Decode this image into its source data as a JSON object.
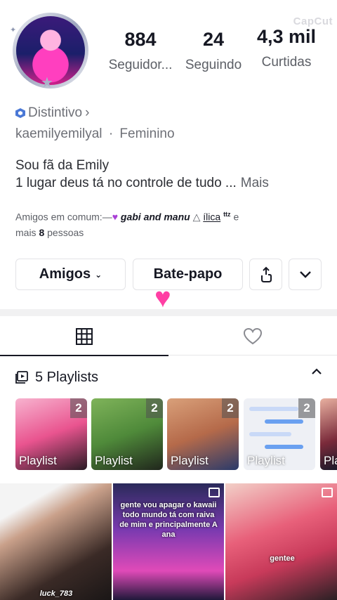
{
  "watermark": "CapCut",
  "stats": [
    {
      "value": "884",
      "label": "Seguidor..."
    },
    {
      "value": "24",
      "label": "Seguindo"
    },
    {
      "value": "4,3 mil",
      "label": "Curtidas"
    }
  ],
  "badge": {
    "label": "Distintivo",
    "arrow": "›"
  },
  "user": {
    "handle": "kaemilyemilyal",
    "separator": "·",
    "gender": "Feminino"
  },
  "bio": {
    "line1": "Sou fã da Emily",
    "line2": "1 lugar deus tá no controle de tudo ...",
    "more": "Mais"
  },
  "friends": {
    "prefix": "Amigos em comum:",
    "name1": "gabi and manu",
    "name2": "ílica",
    "suffix_e": "e",
    "mais": "mais",
    "count": "8",
    "pessoas": "pessoas"
  },
  "buttons": {
    "friends": "Amigos",
    "chat": "Bate-papo"
  },
  "playlists": {
    "title": "5 Playlists",
    "items": [
      {
        "name": "Playlist",
        "count": "2",
        "color": "#e9548f"
      },
      {
        "name": "Playlist",
        "count": "2",
        "color": "#4f8a3a"
      },
      {
        "name": "Playlist",
        "count": "2",
        "color": "#b56a4a"
      },
      {
        "name": "Playlist",
        "count": "2",
        "color": "#e8eaf2"
      },
      {
        "name": "Pla",
        "count": "",
        "color": "#7a2a3a"
      }
    ]
  },
  "posts": [
    {
      "caption": "luck_783"
    },
    {
      "caption": "gente vou apagar o kawaii todo mundo tá com raiva de mim e principalmente A ana"
    },
    {
      "caption": "gentee"
    }
  ]
}
